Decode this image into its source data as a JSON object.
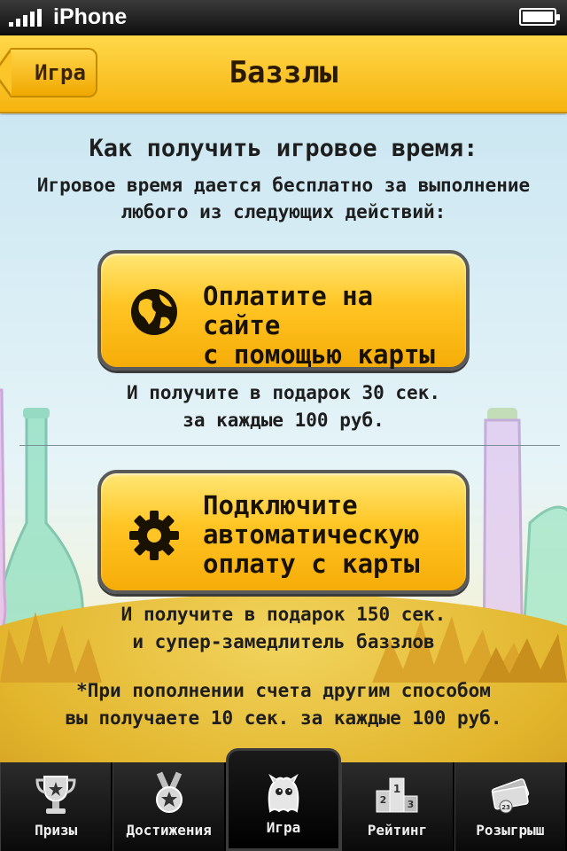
{
  "status_bar": {
    "carrier": "iPhone"
  },
  "nav_bar": {
    "back_label": "Игра",
    "title": "Баззлы"
  },
  "main": {
    "heading": "Как получить игровое время:",
    "intro_line1": "Игровое время дается бесплатно за выполнение",
    "intro_line2": "любого из следующих действий:",
    "pay_button": {
      "line1": "Оплатите на сайте",
      "line2": "с помощью карты",
      "icon": "globe-icon"
    },
    "pay_note": {
      "line1": "И получите в подарок 30 сек.",
      "line2": "за каждые 100 руб."
    },
    "auto_button": {
      "line1": "Подключите",
      "line2": "автоматическую",
      "line3": "оплату с карты",
      "icon": "gear-icon"
    },
    "auto_note": {
      "line1": "И получите в подарок 150 сек.",
      "line2": "и супер-замедлитель баззлов"
    },
    "footnote": {
      "line1": "*При пополнении счета другим способом",
      "line2": "вы получаете 10 сек. за каждые 100 руб."
    }
  },
  "tab_bar": {
    "active": "Игра",
    "tabs": [
      {
        "label": "Призы",
        "icon": "trophy-icon"
      },
      {
        "label": "Достижения",
        "icon": "medal-icon"
      },
      {
        "label": "Игра",
        "icon": "buzzle-mascot-icon"
      },
      {
        "label": "Рейтинг",
        "icon": "podium-icon"
      },
      {
        "label": "Розыгрыш",
        "icon": "tickets-icon"
      }
    ]
  },
  "colors": {
    "accent": "#f6b40f",
    "button_fill": "#ffc524",
    "tab_bar": "#111111"
  }
}
